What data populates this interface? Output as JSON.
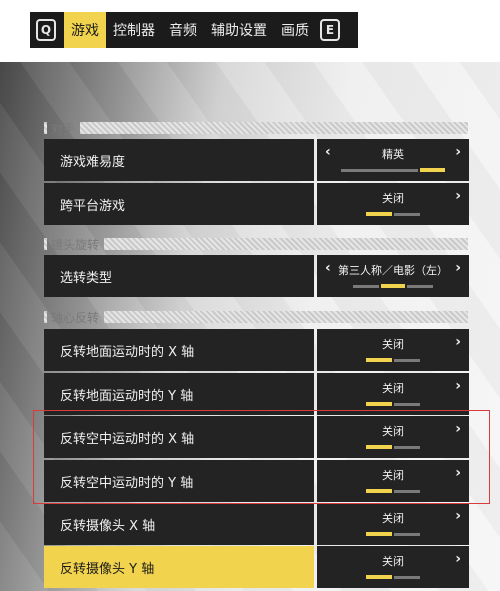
{
  "tabs": {
    "left_key": "Q",
    "right_key": "E",
    "items": [
      {
        "label": "游戏",
        "active": true
      },
      {
        "label": "控制器",
        "active": false
      },
      {
        "label": "音频",
        "active": false
      },
      {
        "label": "辅助设置",
        "active": false
      },
      {
        "label": "画质",
        "active": false
      }
    ]
  },
  "sections": {
    "opponent": "对手",
    "camera_rotation": "镜头旋转",
    "axis_invert": "轴心反转"
  },
  "settings": [
    {
      "label": "游戏难易度",
      "value": "精英"
    },
    {
      "label": "跨平台游戏",
      "value": "关闭"
    },
    {
      "label": "选转类型",
      "value": "第三人称／电影（左）"
    },
    {
      "label": "反转地面运动时的 X 轴",
      "value": "关闭"
    },
    {
      "label": "反转地面运动时的 Y 轴",
      "value": "关闭"
    },
    {
      "label": "反转空中运动时的 X 轴",
      "value": "关闭"
    },
    {
      "label": "反转空中运动时的 Y 轴",
      "value": "关闭"
    },
    {
      "label": "反转摄像头 X 轴",
      "value": "关闭"
    },
    {
      "label": "反转摄像头 Y 轴",
      "value": "关闭"
    }
  ],
  "colors": {
    "accent": "#f2d34d",
    "panel": "#232323",
    "annotation": "#d83c3c"
  },
  "icons": {
    "left": "chevron-left-icon",
    "right": "chevron-right-icon"
  }
}
